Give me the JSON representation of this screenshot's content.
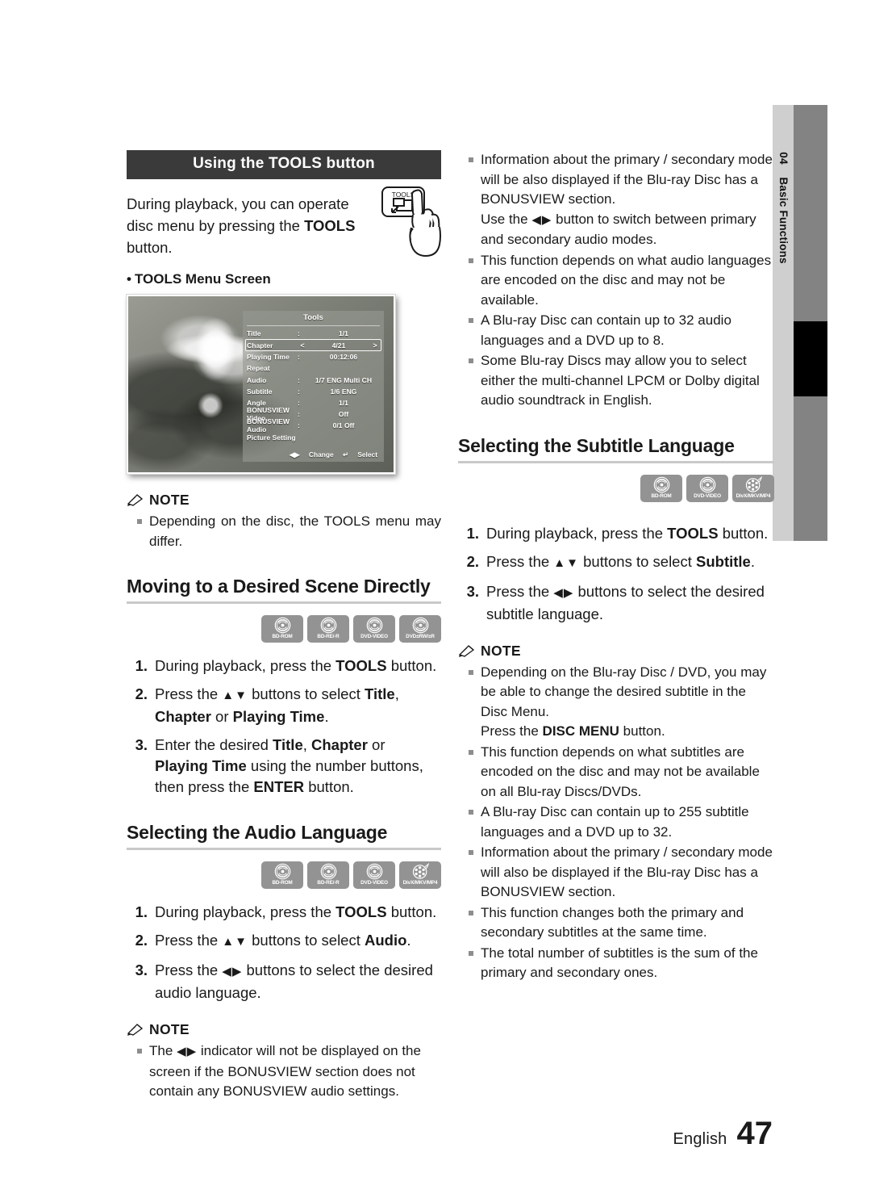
{
  "sidebar": {
    "chapter_number": "04",
    "chapter_title": "Basic Functions"
  },
  "footer": {
    "language": "English",
    "page_number": "47"
  },
  "left_column": {
    "title_bar": "Using the TOOLS button",
    "intro_part1": "During playback, you can operate disc menu by pressing the ",
    "intro_bold": "TOOLS",
    "intro_part2": " button.",
    "remote_button_label": "TOOLS",
    "menu_screen_caption": "TOOLS Menu Screen",
    "tools_screen": {
      "panel_title": "Tools",
      "rows": [
        {
          "label": "Title",
          "colon": ":",
          "value": "1/1",
          "selected": false
        },
        {
          "label": "Chapter",
          "colon": "",
          "value": "4/21",
          "selected": true,
          "left_arrow": "<",
          "right_arrow": ">"
        },
        {
          "label": "Playing Time",
          "colon": ":",
          "value": "00:12:06",
          "selected": false
        },
        {
          "label": "Repeat",
          "colon": "",
          "value": "",
          "selected": false
        },
        {
          "label": "Audio",
          "colon": ":",
          "value": "1/7 ENG Multi CH",
          "selected": false
        },
        {
          "label": "Subtitle",
          "colon": ":",
          "value": "1/6 ENG",
          "selected": false
        },
        {
          "label": "Angle",
          "colon": ":",
          "value": "1/1",
          "selected": false
        },
        {
          "label": "BONUSVIEW Video",
          "colon": ":",
          "value": "Off",
          "selected": false
        },
        {
          "label": "BONUSVIEW Audio",
          "colon": ":",
          "value": "0/1 Off",
          "selected": false
        },
        {
          "label": "Picture Setting",
          "colon": "",
          "value": "",
          "selected": false
        }
      ],
      "footer_change": "Change",
      "footer_select": "Select"
    },
    "note1": {
      "heading": "NOTE",
      "items": [
        "Depending on the disc, the TOOLS menu may differ."
      ]
    },
    "section_scene": {
      "heading": "Moving to a Desired Scene Directly",
      "discs": [
        {
          "name": "BD-ROM",
          "type": "disc"
        },
        {
          "name": "BD-RE/-R",
          "type": "disc"
        },
        {
          "name": "DVD-VIDEO",
          "type": "disc"
        },
        {
          "name": "DVD±RW/±R",
          "type": "disc"
        }
      ],
      "steps": [
        {
          "num": "1.",
          "html": "During playback, press the <b>TOOLS</b> button."
        },
        {
          "num": "2.",
          "html": "Press the <span class=\"arrows\">▲▼</span> buttons to select <b>Title</b>, <b>Chapter</b> or <b>Playing Time</b>."
        },
        {
          "num": "3.",
          "html": "Enter the desired <b>Title</b>, <b>Chapter</b> or <b>Playing Time</b> using the number buttons, then press the <b>ENTER</b> button."
        }
      ]
    },
    "section_audio": {
      "heading": "Selecting the Audio Language",
      "discs": [
        {
          "name": "BD-ROM",
          "type": "disc"
        },
        {
          "name": "BD-RE/-R",
          "type": "disc"
        },
        {
          "name": "DVD-VIDEO",
          "type": "disc"
        },
        {
          "name": "DivX/MKV/MP4",
          "type": "film"
        }
      ],
      "steps": [
        {
          "num": "1.",
          "html": "During playback, press the <b>TOOLS</b> button."
        },
        {
          "num": "2.",
          "html": "Press the <span class=\"arrows\">▲▼</span> buttons to select <b>Audio</b>."
        },
        {
          "num": "3.",
          "html": "Press the <span class=\"arrows\">◀▶</span> buttons to select the desired audio language."
        }
      ],
      "note": {
        "heading": "NOTE",
        "items": [
          "The <span class=\"arrows\">◀▶</span> indicator will not be displayed on the screen if the BONUSVIEW section does not contain any BONUSVIEW audio settings."
        ]
      }
    }
  },
  "right_column": {
    "top_notes": [
      "Information about the primary / secondary mode will be also displayed if the Blu-ray Disc has a BONUSVIEW section.<br>Use the <span class=\"arrows\">◀▶</span> button to switch between primary and secondary audio modes.",
      "This function depends on what audio languages are encoded on the disc and may not be available.",
      "A Blu-ray Disc can contain up to 32 audio languages and a DVD up to 8.",
      "Some Blu-ray Discs may allow you to select either the multi-channel LPCM or Dolby digital audio soundtrack in English."
    ],
    "section_subtitle": {
      "heading": "Selecting the Subtitle Language",
      "discs": [
        {
          "name": "BD-ROM",
          "type": "disc"
        },
        {
          "name": "DVD-VIDEO",
          "type": "disc"
        },
        {
          "name": "DivX/MKV/MP4",
          "type": "film"
        }
      ],
      "steps": [
        {
          "num": "1.",
          "html": "During playback, press the <b>TOOLS</b> button."
        },
        {
          "num": "2.",
          "html": "Press the <span class=\"arrows\">▲▼</span> buttons to select <b>Subtitle</b>."
        },
        {
          "num": "3.",
          "html": "Press the <span class=\"arrows\">◀▶</span> buttons to select the desired subtitle language."
        }
      ],
      "note": {
        "heading": "NOTE",
        "items": [
          "Depending on the Blu-ray Disc / DVD, you may be able to change the desired subtitle in the Disc Menu.<br>Press the <b>DISC MENU</b> button.",
          "This function depends on what subtitles are encoded on the disc and may not be available on all Blu-ray Discs/DVDs.",
          "A Blu-ray Disc can contain up to 255 subtitle languages and a DVD up to 32.",
          "Information about the primary / secondary mode will also be displayed if the Blu-ray Disc has a BONUSVIEW section.",
          "This function changes both the primary and secondary subtitles at the same time.",
          "The total number of subtitles is the sum of the primary and secondary ones."
        ]
      }
    }
  }
}
